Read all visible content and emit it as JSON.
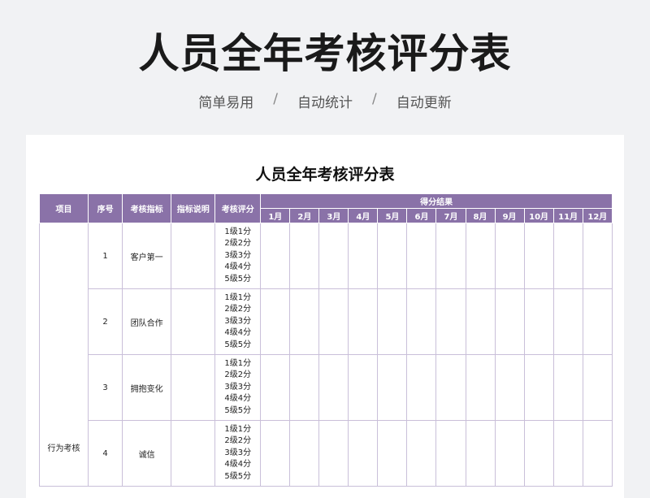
{
  "banner": {
    "title": "人员全年考核评分表",
    "tags": [
      "简单易用",
      "自动统计",
      "自动更新"
    ],
    "separator": "/"
  },
  "sheet": {
    "title": "人员全年考核评分表",
    "headers": {
      "item": "项目",
      "seq": "序号",
      "indicator": "考核指标",
      "desc": "指标说明",
      "score": "考核评分",
      "result": "得分结果"
    },
    "months": [
      "1月",
      "2月",
      "3月",
      "4月",
      "5月",
      "6月",
      "7月",
      "8月",
      "9月",
      "10月",
      "11月",
      "12月"
    ],
    "category": "行为考核",
    "levels": [
      "1级1分",
      "2级2分",
      "3级3分",
      "4级4分",
      "5级5分"
    ],
    "rows": [
      {
        "seq": "1",
        "indicator": "客户第一"
      },
      {
        "seq": "2",
        "indicator": "团队合作"
      },
      {
        "seq": "3",
        "indicator": "拥抱变化"
      },
      {
        "seq": "4",
        "indicator": "诚信"
      }
    ]
  },
  "colors": {
    "header_bg": "#8a72a8",
    "border": "#c9bfd9",
    "page_bg": "#f1f2f4"
  }
}
